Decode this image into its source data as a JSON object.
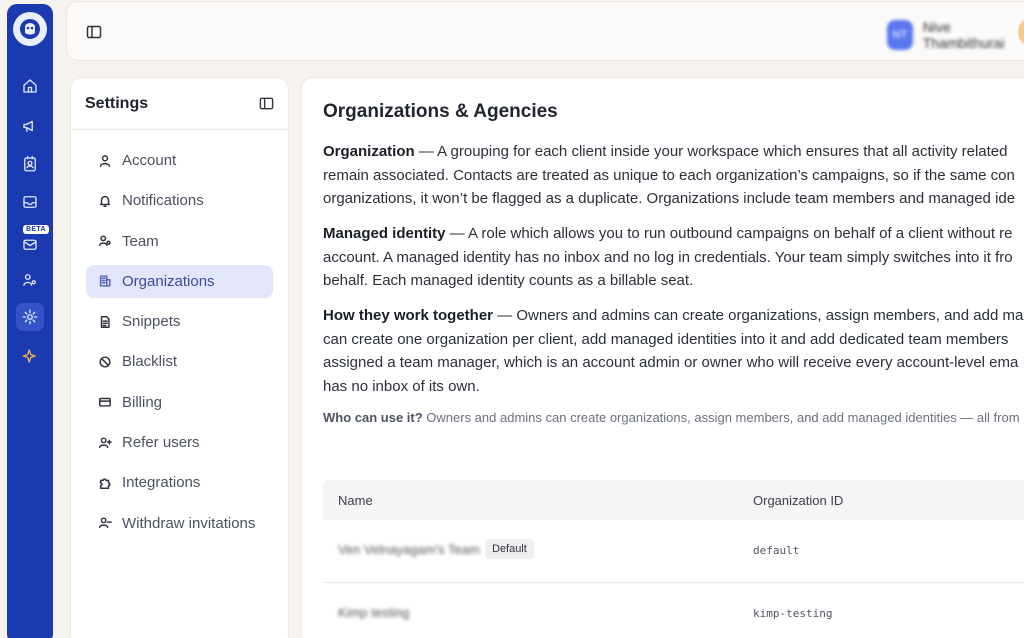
{
  "topbar": {
    "user_initials": "NT",
    "user_name": "Nive Thambithurai"
  },
  "rail": {
    "beta_label": "BETA",
    "icons": [
      "home-icon",
      "megaphone-icon",
      "contacts-icon",
      "inbox-icon",
      "mail-icon",
      "team-icon",
      "settings-icon",
      "sparkles-icon"
    ]
  },
  "settings": {
    "title": "Settings",
    "items": [
      {
        "label": "Account",
        "icon": "user-icon"
      },
      {
        "label": "Notifications",
        "icon": "bell-icon"
      },
      {
        "label": "Team",
        "icon": "team-icon"
      },
      {
        "label": "Organizations",
        "icon": "building-icon",
        "active": true
      },
      {
        "label": "Snippets",
        "icon": "document-icon"
      },
      {
        "label": "Blacklist",
        "icon": "ban-icon"
      },
      {
        "label": "Billing",
        "icon": "card-icon"
      },
      {
        "label": "Refer users",
        "icon": "user-plus-icon"
      },
      {
        "label": "Integrations",
        "icon": "puzzle-icon"
      },
      {
        "label": "Withdraw invitations",
        "icon": "user-minus-icon"
      }
    ]
  },
  "main": {
    "title": "Organizations & Agencies",
    "org": {
      "term": "Organization",
      "line1": " — A grouping for each client inside your workspace which ensures that all activity related",
      "line2": "remain associated. Contacts are treated as unique to each organization’s campaigns, so if the same con",
      "line3": "organizations, it won’t be flagged as a duplicate. Organizations include team members and managed ide"
    },
    "managed": {
      "term": "Managed identity",
      "line1": " — A role which allows you to run outbound campaigns on behalf of a client without re",
      "line2": "account. A managed identity has no inbox and no log in credentials. Your team simply switches into it fro",
      "line3": "behalf. Each managed identity counts as a billable seat."
    },
    "together": {
      "term": "How they work together",
      "line1": " — Owners and admins can create organizations, assign members, and add ma",
      "line2": "can create one organization per client, add managed identities into it and add dedicated team members",
      "line3": "assigned a team manager, which is an account admin or owner who will receive every account-level ema",
      "line4": "has no inbox of its own."
    },
    "who": {
      "term": "Who can use it?",
      "text": " Owners and admins can create organizations, assign members, and add managed identities — all from"
    },
    "table": {
      "headers": {
        "name": "Name",
        "id": "Organization ID"
      },
      "rows": [
        {
          "name": "Ven Velnayagam's Team",
          "badge": "Default",
          "id": "default"
        },
        {
          "name": "Kimp testing",
          "id": "kimp-testing"
        }
      ]
    }
  }
}
